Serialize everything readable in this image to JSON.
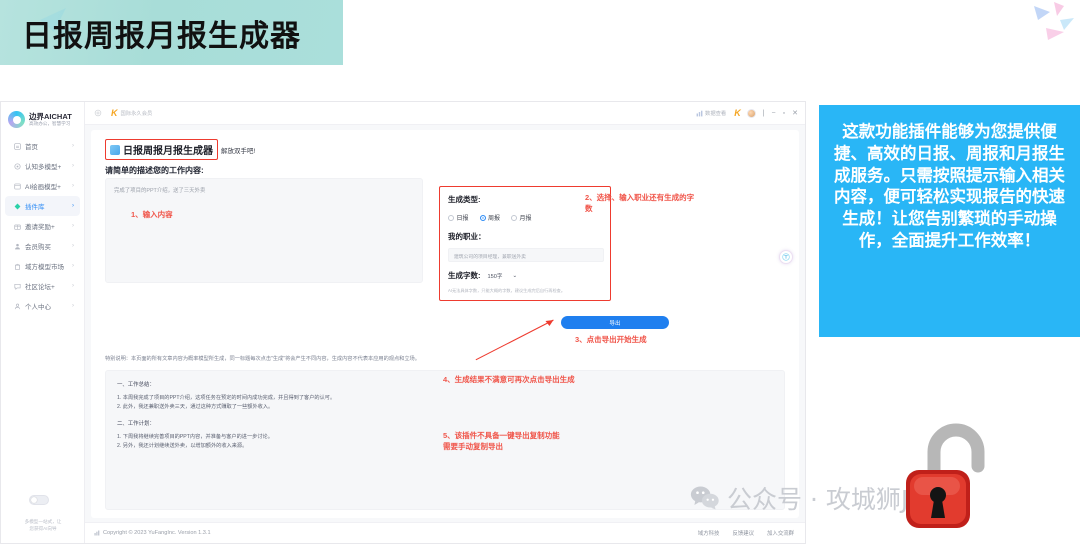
{
  "banner": {
    "title": "日报周报月报生成器"
  },
  "info_panel": {
    "text": "这款功能插件能够为您提供便捷、高效的日报、周报和月报生成服务。只需按照提示输入相关内容，便可轻松实现报告的快速生成！让您告别繁琐的手动操作，全面提升工作效率！"
  },
  "sidebar": {
    "brand_name": "边界AICHAT",
    "brand_tagline": "高效办公，智慧学习",
    "items": [
      {
        "label": "首页",
        "icon": "home-icon",
        "active": false
      },
      {
        "label": "认知多模型+",
        "icon": "model-icon",
        "active": false
      },
      {
        "label": "AI绘画模型+",
        "icon": "paint-icon",
        "active": false
      },
      {
        "label": "插件库",
        "icon": "plugin-icon",
        "active": true
      },
      {
        "label": "邀请奖励+",
        "icon": "gift-icon",
        "active": false
      },
      {
        "label": "会员购买",
        "icon": "member-icon",
        "active": false
      },
      {
        "label": "域方模型市场",
        "icon": "market-icon",
        "active": false
      },
      {
        "label": "社区论坛+",
        "icon": "forum-icon",
        "active": false
      },
      {
        "label": "个人中心",
        "icon": "user-icon",
        "active": false
      }
    ],
    "footer_line1": "多模型一站式，让",
    "footer_line2": "您获得AI向导"
  },
  "topbar": {
    "gear_icon": "gear-icon",
    "k_logo": "K",
    "k_text": "国际永久会员",
    "data_label": "数据查看",
    "k_badge": "K",
    "window_controls": [
      "minimize",
      "maximize",
      "close"
    ]
  },
  "plugin": {
    "title": "日报周报月报生成器",
    "subtitle": "解放双手吧!",
    "icon": "plugin-app-icon"
  },
  "form": {
    "work_label": "请简单的描述您的工作内容:",
    "work_placeholder": "完成了项目的PPT介绍，送了三天外卖",
    "type_label": "生成类型:",
    "type_options": [
      {
        "label": "日报",
        "selected": false
      },
      {
        "label": "周报",
        "selected": true
      },
      {
        "label": "月报",
        "selected": false
      }
    ],
    "job_label": "我的职业：",
    "job_placeholder": "建筑公司的项目经理，兼职送外卖",
    "count_label": "生成字数:",
    "count_value": "150字",
    "count_note": "AI无法具体字数，只能大概的字数，建议生成完后自行再检查。",
    "export_button": "导出"
  },
  "annotations": {
    "a1": "1、输入内容",
    "a2": "2、选择、输入职业还有生成的字数",
    "a3": "3、点击导出开始生成",
    "a4": "4、生成结果不满意可再次点击导出生成",
    "a5_line1": "5、该插件不具备一键导出复制功能",
    "a5_line2": "需要手动复制导出"
  },
  "disclaimer": "特别说明：本页面的所有文章内容为概率模型所生成，同一标题每次点击\"生成\"将会产生不同内容，生成内容不代表本应用的观点和立场。",
  "result": {
    "section1_title": "一、工作总结：",
    "section1_lines": [
      "1. 本周我完成了项目的PPT介绍，这项任务在预定的时间内成功完成，并且得到了客户的认可。",
      "2. 此外，我还兼职送外卖三天，通过这种方式赚取了一些额外收入。"
    ],
    "section2_title": "二、工作计划：",
    "section2_lines": [
      "1. 下周我将继续完善项目的PPT内容，并准备与客户的进一步讨论。",
      "2. 另外，我还计划继续送外卖，以增加额外的收入来源。"
    ]
  },
  "footer": {
    "copyright": "Copyright © 2023 YuFangInc. Version 1.3.1",
    "links": [
      "域方科技",
      "反馈建议",
      "加入交流群"
    ]
  },
  "watermark": {
    "text": "公众号 · 攻城狮Joker",
    "wechat_icon": "wechat-icon",
    "lock_icon": "open-padlock-icon"
  }
}
